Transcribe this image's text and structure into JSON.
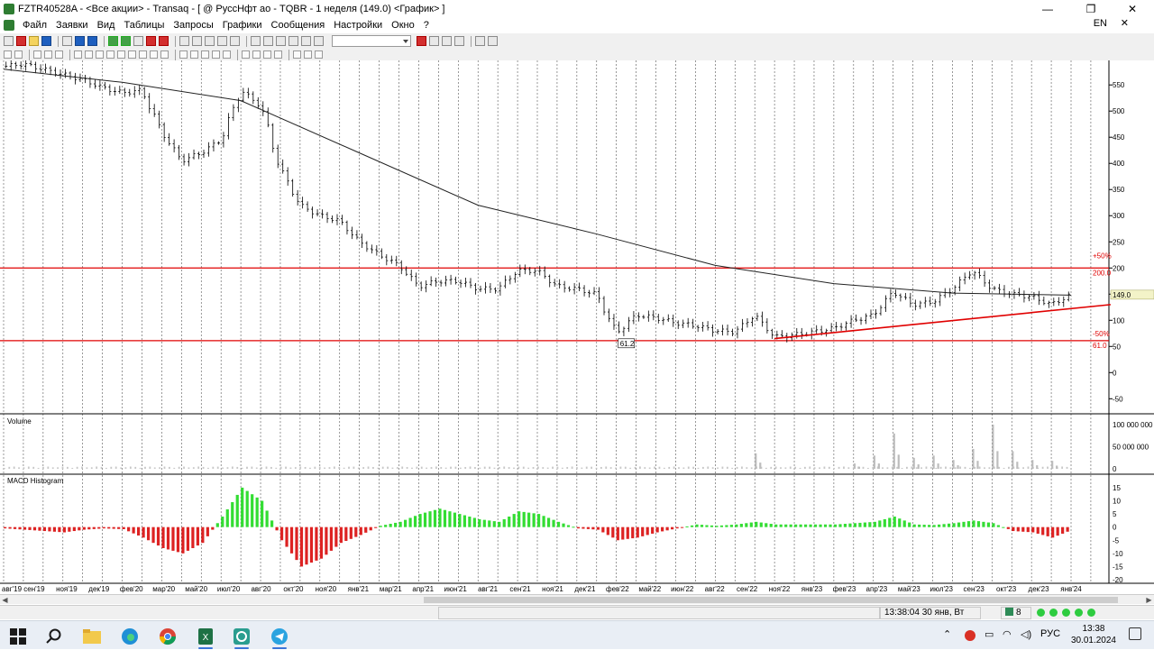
{
  "window": {
    "title": "FZTR40528A - <Все акции> - Transaq - [ @ РусcНфт ао - TQBR - 1 неделя (149.0) <График> ]",
    "minimize_glyph": "—",
    "restore_glyph": "❐",
    "close_glyph": "✕"
  },
  "menu": {
    "items": [
      "Файл",
      "Заявки",
      "Вид",
      "Таблицы",
      "Запросы",
      "Графики",
      "Сообщения",
      "Настройки",
      "Окно",
      "?"
    ],
    "language": "EN",
    "close_glyph": "✕"
  },
  "toolbar": {
    "icons": [
      "new-icon",
      "save-icon",
      "open-icon",
      "print-icon",
      "back-icon",
      "forward-icon",
      "refresh-icon",
      "order-icon",
      "stop-icon",
      "sum-icon",
      "filter-icon",
      "chart-icon",
      "table-icon",
      "settings-icon"
    ],
    "instrument_select": ""
  },
  "chart_data": [
    {
      "type": "candlestick",
      "title": "",
      "panel": "price",
      "timeframe": "1 неделя",
      "x_tick_labels": [
        "авг'19",
        "сен'19",
        "ноя'19",
        "дек'19",
        "фев'20",
        "мар'20",
        "май'20",
        "июл'20",
        "авг'20",
        "окт'20",
        "ноя'20",
        "янв'21",
        "мар'21",
        "апр'21",
        "июн'21",
        "авг'21",
        "сен'21",
        "ноя'21",
        "дек'21",
        "фев'22",
        "май'22",
        "июн'22",
        "авг'22",
        "сен'22",
        "ноя'22",
        "янв'23",
        "фев'23",
        "апр'23",
        "май'23",
        "июл'23",
        "сен'23",
        "окт'23",
        "дек'23",
        "янв'24"
      ],
      "y_tick_labels": [
        "550",
        "500",
        "450",
        "400",
        "350",
        "300",
        "250",
        "200",
        "150",
        "100",
        "50",
        "0",
        "-50"
      ],
      "ylim": [
        -65,
        590
      ],
      "close_series": [
        [
          "2019-07",
          585
        ],
        [
          "2019-08",
          590
        ],
        [
          "2019-09",
          580
        ],
        [
          "2019-10",
          570
        ],
        [
          "2019-11",
          560
        ],
        [
          "2019-12",
          545
        ],
        [
          "2020-01",
          535
        ],
        [
          "2020-02",
          540
        ],
        [
          "2020-03",
          460
        ],
        [
          "2020-04",
          405
        ],
        [
          "2020-05",
          420
        ],
        [
          "2020-06",
          445
        ],
        [
          "2020-07",
          540
        ],
        [
          "2020-08",
          510
        ],
        [
          "2020-09",
          390
        ],
        [
          "2020-10",
          320
        ],
        [
          "2020-11",
          300
        ],
        [
          "2020-12",
          290
        ],
        [
          "2021-01",
          250
        ],
        [
          "2021-02",
          225
        ],
        [
          "2021-03",
          205
        ],
        [
          "2021-04",
          165
        ],
        [
          "2021-05",
          175
        ],
        [
          "2021-06",
          175
        ],
        [
          "2021-07",
          160
        ],
        [
          "2021-08",
          160
        ],
        [
          "2021-09",
          195
        ],
        [
          "2021-10",
          195
        ],
        [
          "2021-11",
          165
        ],
        [
          "2021-12",
          160
        ],
        [
          "2022-01",
          150
        ],
        [
          "2022-02",
          75
        ],
        [
          "2022-03",
          110
        ],
        [
          "2022-04",
          105
        ],
        [
          "2022-05",
          95
        ],
        [
          "2022-06",
          90
        ],
        [
          "2022-07",
          80
        ],
        [
          "2022-08",
          78
        ],
        [
          "2022-09",
          110
        ],
        [
          "2022-10",
          68
        ],
        [
          "2022-11",
          72
        ],
        [
          "2022-12",
          78
        ],
        [
          "2023-01",
          85
        ],
        [
          "2023-02",
          100
        ],
        [
          "2023-03",
          110
        ],
        [
          "2023-04",
          155
        ],
        [
          "2023-05",
          130
        ],
        [
          "2023-06",
          135
        ],
        [
          "2023-07",
          160
        ],
        [
          "2023-08",
          195
        ],
        [
          "2023-09",
          160
        ],
        [
          "2023-10",
          150
        ],
        [
          "2023-11",
          145
        ],
        [
          "2023-12",
          130
        ],
        [
          "2024-01",
          149
        ]
      ],
      "moving_average": [
        [
          "2019-07",
          580
        ],
        [
          "2020-01",
          555
        ],
        [
          "2020-07",
          520
        ],
        [
          "2021-01",
          420
        ],
        [
          "2021-07",
          320
        ],
        [
          "2022-01",
          265
        ],
        [
          "2022-07",
          205
        ],
        [
          "2023-01",
          170
        ],
        [
          "2023-07",
          152
        ],
        [
          "2024-01",
          148
        ]
      ],
      "horizontal_lines": [
        {
          "value": 200,
          "label": "200.0",
          "color": "#e00000"
        },
        {
          "value": 61.0,
          "label": "61.0",
          "color": "#e00000"
        }
      ],
      "trendline": {
        "from": [
          "2022-10",
          65
        ],
        "to": [
          "2024-02",
          130
        ],
        "color": "#e00000"
      },
      "annotations": [
        {
          "text": "+50%",
          "color": "#e00000"
        },
        {
          "text": "-50%",
          "color": "#e00000"
        },
        {
          "text": "61.2",
          "note": "low marker"
        },
        {
          "text": "149.0",
          "note": "last price tag"
        }
      ]
    },
    {
      "type": "bar",
      "title": "Volume",
      "panel": "volume",
      "y_tick_labels": [
        "100 000 000",
        "50 000 000",
        "0"
      ],
      "ylim": [
        0,
        100000000
      ],
      "spikes": [
        [
          "2022-09",
          35000000
        ],
        [
          "2023-02",
          12000000
        ],
        [
          "2023-03",
          30000000
        ],
        [
          "2023-04",
          80000000
        ],
        [
          "2023-05",
          25000000
        ],
        [
          "2023-06",
          30000000
        ],
        [
          "2023-07",
          20000000
        ],
        [
          "2023-08",
          45000000
        ],
        [
          "2023-09",
          100000000
        ],
        [
          "2023-10",
          40000000
        ],
        [
          "2023-11",
          20000000
        ],
        [
          "2023-12",
          18000000
        ]
      ]
    },
    {
      "type": "bar",
      "title": "MACD Histogram",
      "panel": "macd",
      "y_tick_labels": [
        "15",
        "10",
        "5",
        "0",
        "-5",
        "-10",
        "-15",
        "-20"
      ],
      "ylim": [
        -20,
        16
      ],
      "colors": {
        "positive": "#33dd33",
        "negative": "#dd2222"
      },
      "values": [
        [
          "2019-07",
          -0.5
        ],
        [
          "2019-08",
          -1
        ],
        [
          "2019-09",
          -1.5
        ],
        [
          "2019-10",
          -2
        ],
        [
          "2019-11",
          -1
        ],
        [
          "2019-12",
          -0.5
        ],
        [
          "2020-01",
          -0.8
        ],
        [
          "2020-02",
          -4
        ],
        [
          "2020-03",
          -8
        ],
        [
          "2020-04",
          -10
        ],
        [
          "2020-05",
          -6
        ],
        [
          "2020-06",
          4
        ],
        [
          "2020-07",
          15
        ],
        [
          "2020-08",
          10
        ],
        [
          "2020-09",
          -5
        ],
        [
          "2020-10",
          -15
        ],
        [
          "2020-11",
          -12
        ],
        [
          "2020-12",
          -6
        ],
        [
          "2021-01",
          -3
        ],
        [
          "2021-02",
          0.5
        ],
        [
          "2021-03",
          2
        ],
        [
          "2021-04",
          5
        ],
        [
          "2021-05",
          7
        ],
        [
          "2021-06",
          5
        ],
        [
          "2021-07",
          3
        ],
        [
          "2021-08",
          2
        ],
        [
          "2021-09",
          6
        ],
        [
          "2021-10",
          5
        ],
        [
          "2021-11",
          2
        ],
        [
          "2021-12",
          -0.5
        ],
        [
          "2022-01",
          -1
        ],
        [
          "2022-02",
          -5
        ],
        [
          "2022-03",
          -4
        ],
        [
          "2022-04",
          -2
        ],
        [
          "2022-05",
          -0.5
        ],
        [
          "2022-06",
          1
        ],
        [
          "2022-07",
          0.5
        ],
        [
          "2022-08",
          1
        ],
        [
          "2022-09",
          2
        ],
        [
          "2022-10",
          1
        ],
        [
          "2022-11",
          1
        ],
        [
          "2022-12",
          1
        ],
        [
          "2023-01",
          1
        ],
        [
          "2023-02",
          1.5
        ],
        [
          "2023-03",
          2
        ],
        [
          "2023-04",
          4
        ],
        [
          "2023-05",
          1
        ],
        [
          "2023-06",
          0.8
        ],
        [
          "2023-07",
          1.5
        ],
        [
          "2023-08",
          2.5
        ],
        [
          "2023-09",
          1.5
        ],
        [
          "2023-10",
          -1.5
        ],
        [
          "2023-11",
          -2
        ],
        [
          "2023-12",
          -4
        ],
        [
          "2024-01",
          -1
        ]
      ]
    }
  ],
  "status": {
    "time": "13:38:04",
    "date": "30 янв, Вт",
    "count": "8"
  },
  "taskbar": {
    "apps": [
      "windows-start-icon",
      "search-icon",
      "file-explorer-icon",
      "edge-icon",
      "chrome-icon",
      "excel-icon",
      "transaq-icon",
      "telegram-icon"
    ],
    "tray_lang": "РУС",
    "clock_time": "13:38",
    "clock_date": "30.01.2024"
  }
}
